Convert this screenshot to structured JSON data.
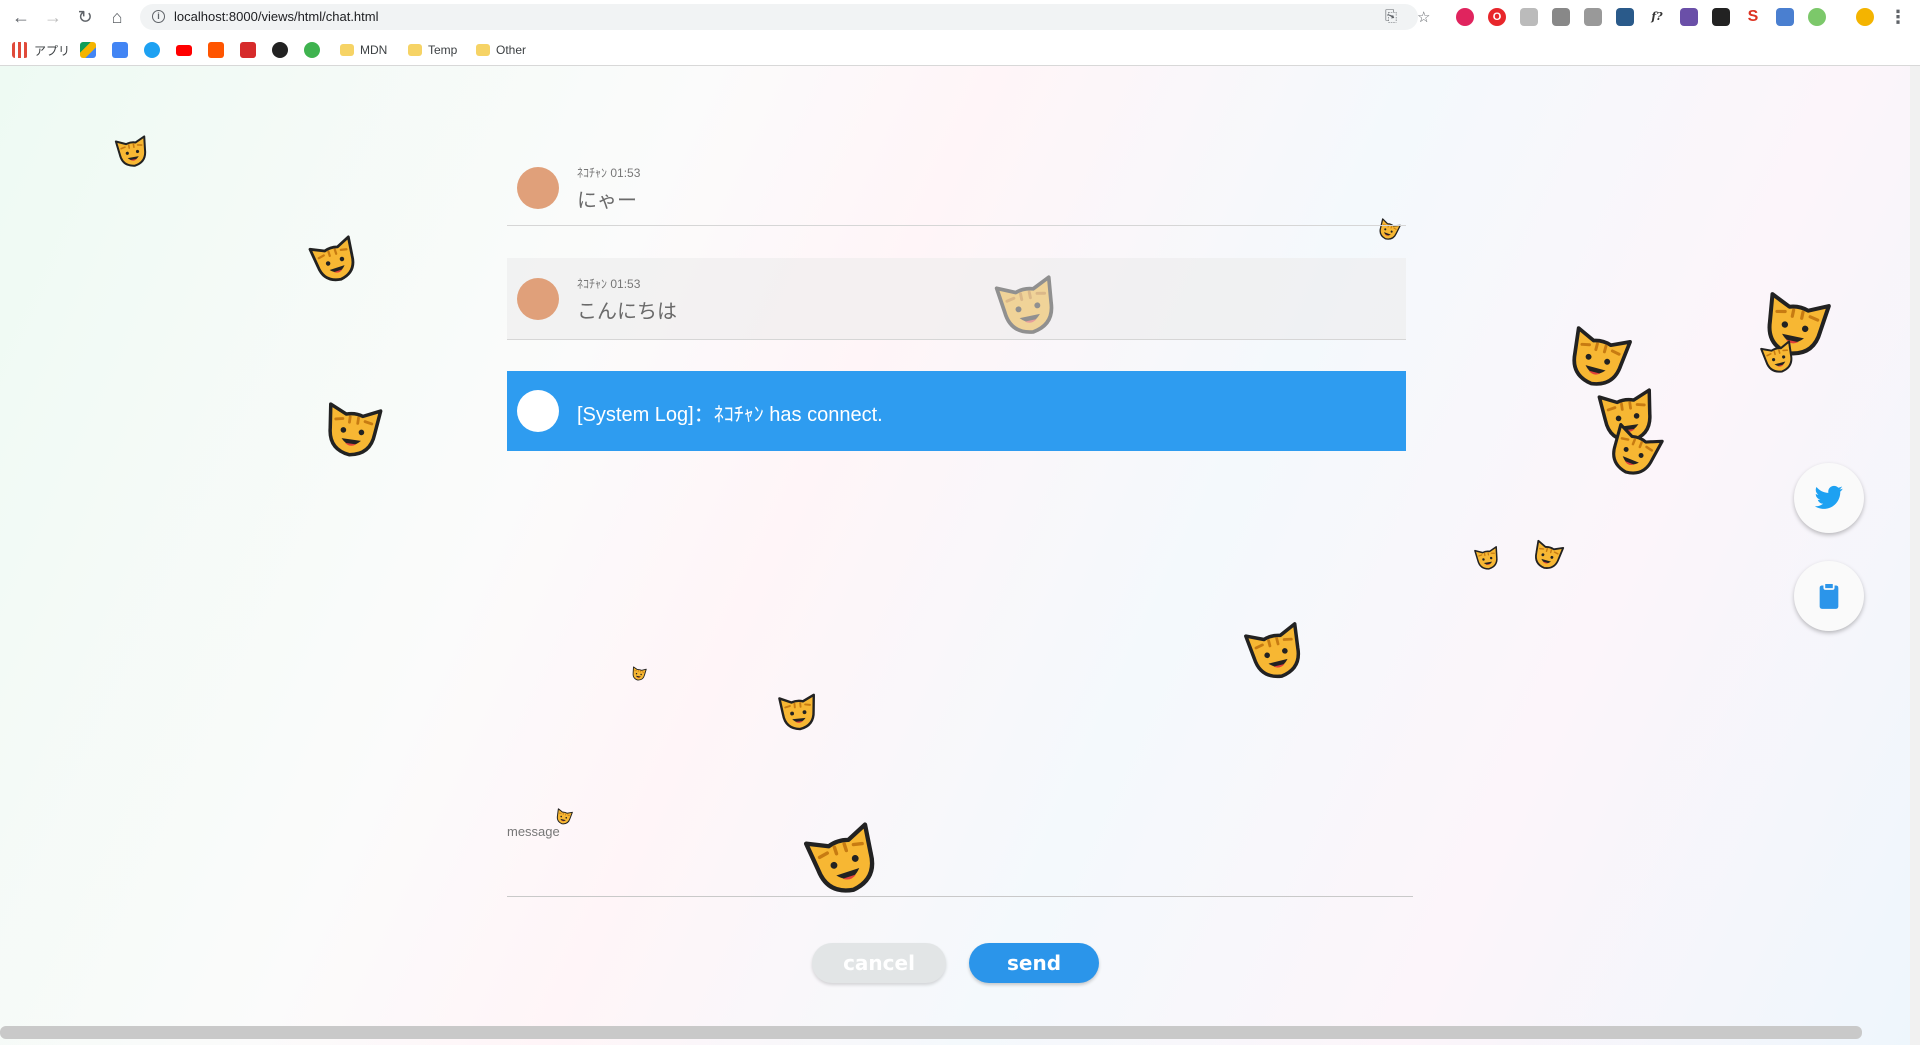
{
  "browser": {
    "url": "localhost:8000/views/html/chat.html",
    "bookmarks": [
      {
        "label": "アプリ",
        "icon": "apps-grid-icon"
      },
      {
        "label": "",
        "icon": "google-drive-icon"
      },
      {
        "label": "",
        "icon": "google-translate-icon"
      },
      {
        "label": "",
        "icon": "twitter-icon"
      },
      {
        "label": "",
        "icon": "youtube-icon"
      },
      {
        "label": "",
        "icon": "soundcloud-icon"
      },
      {
        "label": "",
        "icon": "red-bookmark-icon"
      },
      {
        "label": "",
        "icon": "github-icon"
      },
      {
        "label": "",
        "icon": "green-bookmark-icon"
      },
      {
        "label": "MDN",
        "icon": "folder-icon"
      },
      {
        "label": "Temp",
        "icon": "folder-icon"
      },
      {
        "label": "Other",
        "icon": "folder-icon"
      }
    ]
  },
  "chat": {
    "posts": [
      {
        "author": "ﾈｺﾁｬﾝ",
        "time": "01:53",
        "text": "にゃー"
      },
      {
        "author": "ﾈｺﾁｬﾝ",
        "time": "01:53",
        "text": "こんにちは"
      }
    ],
    "system_log": "[System Log]：ﾈｺﾁｬﾝ has connect."
  },
  "composer": {
    "label": "message",
    "value": "",
    "cancel_label": "cancel",
    "send_label": "send"
  },
  "side_buttons": [
    {
      "icon": "twitter-icon",
      "color": "#1da1f2"
    },
    {
      "icon": "clipboard-icon",
      "color": "#2b95ea"
    }
  ],
  "colors": {
    "accent": "#2b95ea",
    "system_log_bg": "#2e9cf0",
    "avatar": "#e0a07a"
  }
}
